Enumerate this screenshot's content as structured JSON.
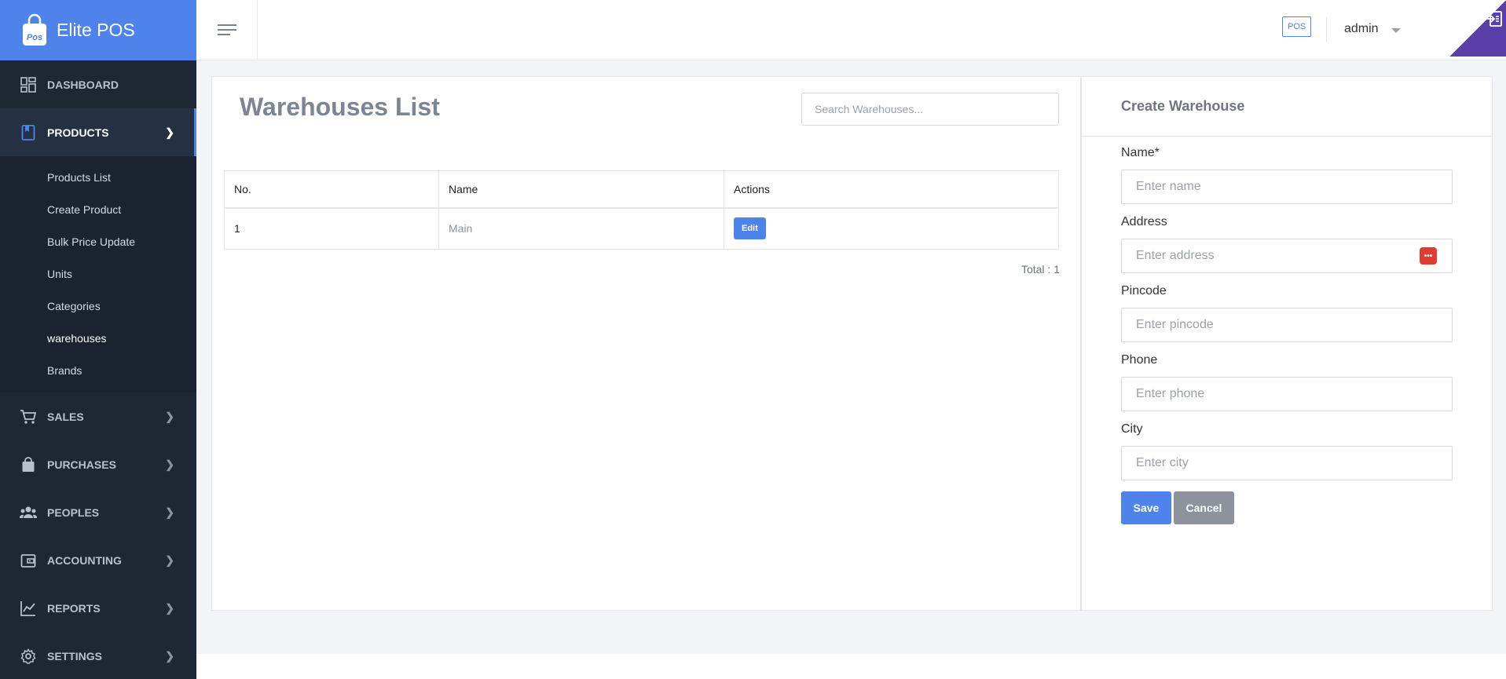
{
  "app": {
    "name": "Elite POS"
  },
  "sidebar": {
    "items": [
      {
        "label": "DASHBOARD",
        "icon": "dashboard-icon"
      },
      {
        "label": "PRODUCTS",
        "icon": "bookmark-icon",
        "active": true
      },
      {
        "label": "SALES",
        "icon": "cart-icon"
      },
      {
        "label": "PURCHASES",
        "icon": "bag-icon"
      },
      {
        "label": "PEOPLES",
        "icon": "people-icon"
      },
      {
        "label": "ACCOUNTING",
        "icon": "wallet-icon"
      },
      {
        "label": "REPORTS",
        "icon": "chart-icon"
      },
      {
        "label": "SETTINGS",
        "icon": "gear-icon"
      }
    ],
    "products_submenu": [
      "Products List",
      "Create Product",
      "Bulk Price Update",
      "Units",
      "Categories",
      "warehouses",
      "Brands"
    ]
  },
  "header": {
    "pos_badge": "POS",
    "user": "admin"
  },
  "list": {
    "title": "Warehouses List",
    "search_placeholder": "Search Warehouses...",
    "columns": [
      "No.",
      "Name",
      "Actions"
    ],
    "rows": [
      {
        "no": "1",
        "name": "Main",
        "action": "Edit"
      }
    ],
    "total": "Total : 1"
  },
  "form": {
    "title": "Create Warehouse",
    "fields": [
      {
        "label": "Name*",
        "placeholder": "Enter name"
      },
      {
        "label": "Address",
        "placeholder": "Enter address"
      },
      {
        "label": "Pincode",
        "placeholder": "Enter pincode"
      },
      {
        "label": "Phone",
        "placeholder": "Enter phone"
      },
      {
        "label": "City",
        "placeholder": "Enter city"
      }
    ],
    "save": "Save",
    "cancel": "Cancel"
  },
  "colors": {
    "accent": "#4e83ec",
    "sidebar_bg": "#1e2835",
    "corner": "#5b3fa8",
    "address_ext": "#e03c31"
  }
}
